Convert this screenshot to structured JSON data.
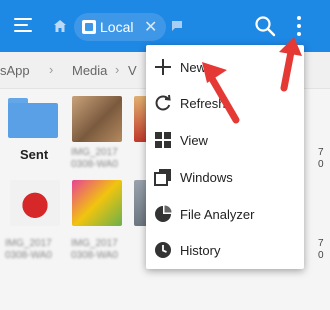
{
  "colors": {
    "appbar": "#1e88e5",
    "annotation_arrow": "#e53935",
    "folder": "#5aa0e6"
  },
  "appbar": {
    "tab_label": "Local",
    "icons": [
      "menu-icon",
      "home-icon",
      "phone-icon",
      "close-icon",
      "flag-icon",
      "search-icon",
      "more-vert-icon"
    ]
  },
  "breadcrumb": {
    "items": [
      "sApp",
      "Media",
      "V"
    ]
  },
  "files": {
    "folder_name": "Sent",
    "thumb_labels": [
      "IMG_2017",
      "0308-WA0"
    ],
    "partial_right_col": [
      "7",
      "0"
    ]
  },
  "menu": {
    "items": [
      {
        "label": "New",
        "icon": "plus-icon"
      },
      {
        "label": "Refresh",
        "icon": "refresh-icon"
      },
      {
        "label": "View",
        "icon": "grid-view-icon"
      },
      {
        "label": "Windows",
        "icon": "windows-icon"
      },
      {
        "label": "File Analyzer",
        "icon": "pie-chart-icon"
      },
      {
        "label": "History",
        "icon": "clock-icon"
      }
    ]
  }
}
